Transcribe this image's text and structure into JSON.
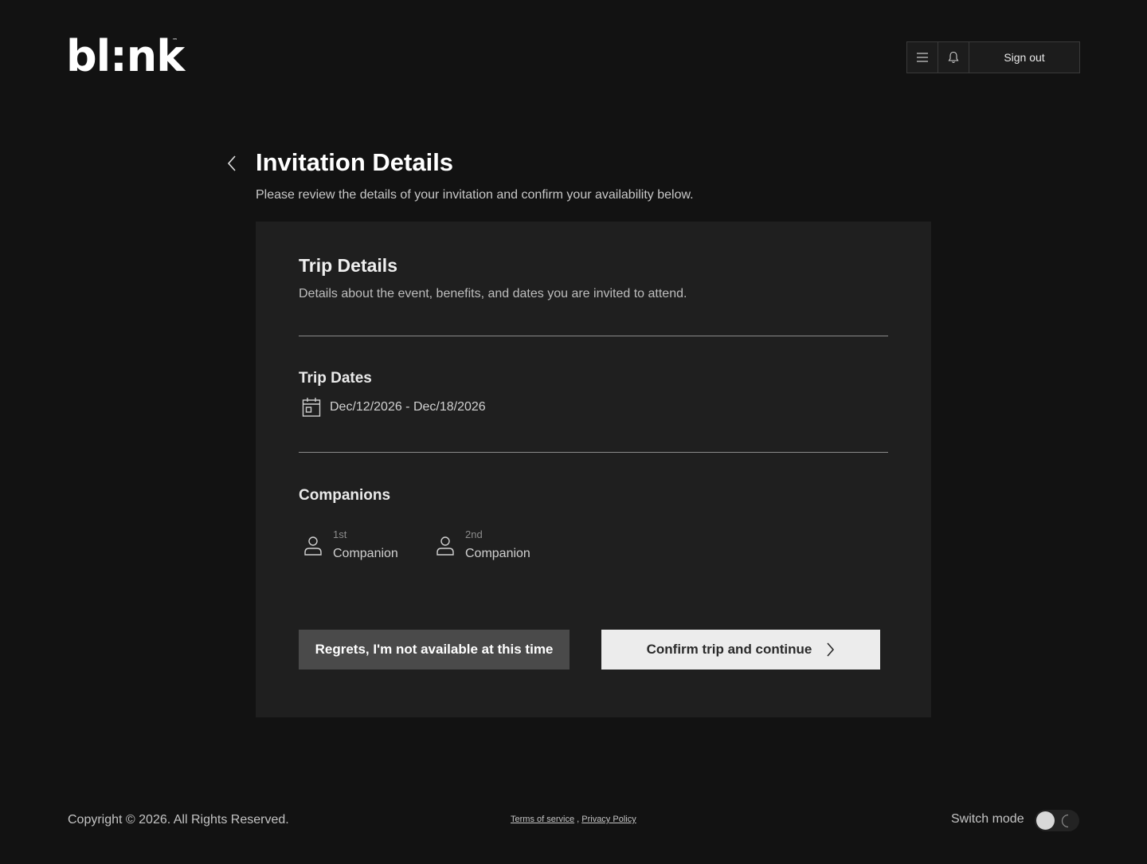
{
  "brand": {
    "logo_text": "bl:nk",
    "trademark": "™"
  },
  "header": {
    "sign_out_label": "Sign out",
    "menu_icon": "menu-icon",
    "bell_icon": "bell-icon"
  },
  "page": {
    "title": "Invitation Details",
    "subtitle": "Please review the details of your invitation and confirm your availability below."
  },
  "card": {
    "title": "Trip Details",
    "description": "Details about the event, benefits, and dates you are invited to attend.",
    "trip_dates": {
      "heading": "Trip Dates",
      "range": "Dec/12/2026 - Dec/18/2026"
    },
    "companions": {
      "heading": "Companions",
      "items": [
        {
          "order": "1st",
          "label": "Companion"
        },
        {
          "order": "2nd",
          "label": "Companion"
        }
      ]
    },
    "actions": {
      "decline_label": "Regrets, I'm not available at this time",
      "confirm_label": "Confirm trip and continue"
    }
  },
  "footer": {
    "copyright": "Copyright © 2026. All Rights Reserved.",
    "terms": "Terms of service",
    "separator": " , ",
    "privacy": "Privacy Policy",
    "switch_mode_label": "Switch mode"
  },
  "colors": {
    "background": "#121212",
    "card": "#1f1f1f",
    "primary_button": "#ececec",
    "secondary_button": "#4a4a4a"
  }
}
